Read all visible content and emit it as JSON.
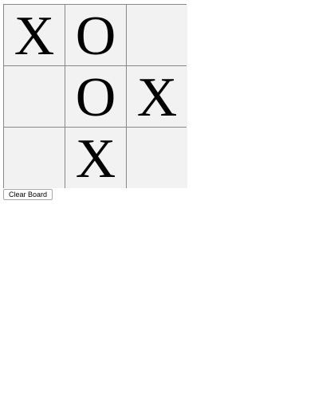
{
  "board": {
    "cells": [
      [
        "X",
        "O",
        ""
      ],
      [
        "",
        "O",
        "X"
      ],
      [
        "",
        "X",
        ""
      ]
    ]
  },
  "controls": {
    "clear_label": "Clear Board"
  }
}
